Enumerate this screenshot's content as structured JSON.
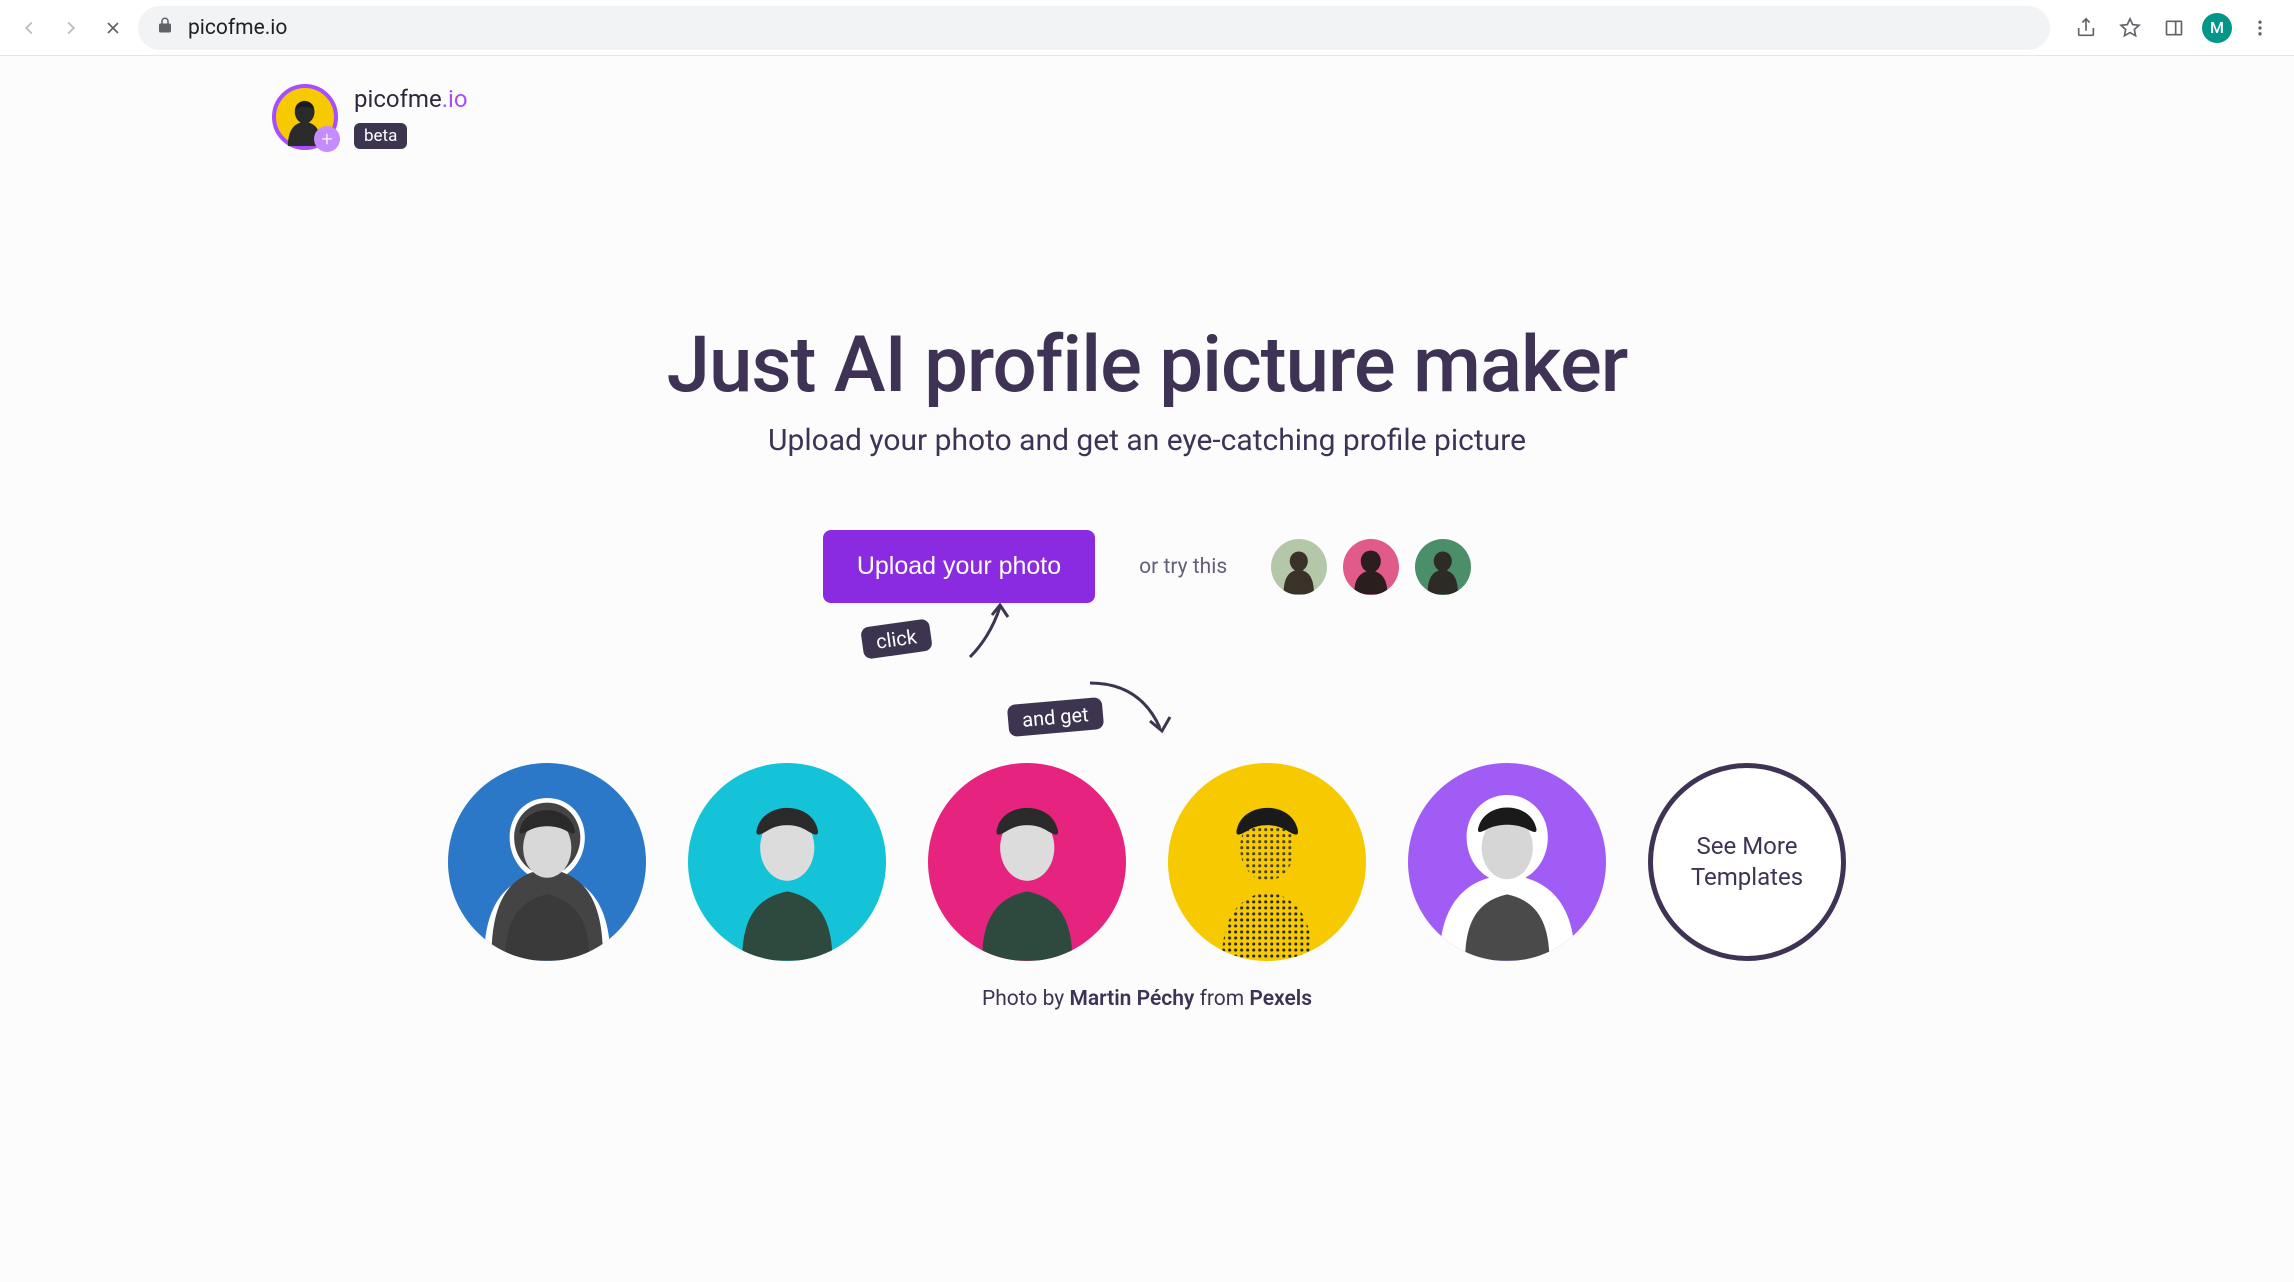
{
  "browser": {
    "url": "picofme.io",
    "profileInitial": "M"
  },
  "header": {
    "brand": "picofme",
    "brandSuffix": ".io",
    "beta": "beta"
  },
  "hero": {
    "title": "Just AI profile picture maker",
    "subtitle": "Upload your photo and get an eye-catching profile picture"
  },
  "cta": {
    "uploadLabel": "Upload your photo",
    "tryLabel": "or try this"
  },
  "hints": {
    "click": "click",
    "andGet": "and get"
  },
  "templates": {
    "seeMore": "See More Templates",
    "colors": [
      "#2b78c8",
      "#14c3d7",
      "#e6247f",
      "#f6c900",
      "#a05cf5"
    ]
  },
  "credit": {
    "prefix": "Photo by ",
    "author": "Martin Péchy",
    "middle": " from ",
    "source": "Pexels"
  }
}
